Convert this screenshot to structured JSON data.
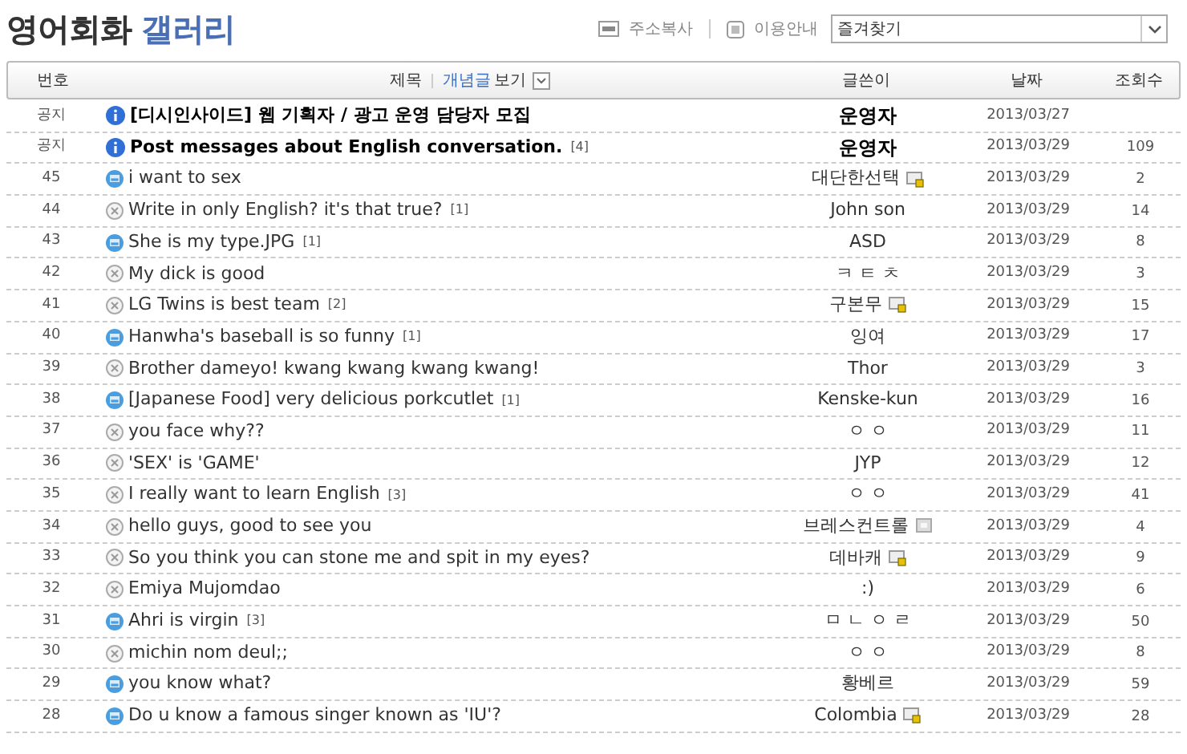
{
  "title": {
    "main": "영어회화",
    "accent": "갤러리"
  },
  "toolbar": {
    "copy_url": "주소복사",
    "guide": "이용안내",
    "favorites": "즐겨찾기"
  },
  "header": {
    "number": "번호",
    "subject": "제목",
    "concept": "개념글",
    "view": "보기",
    "writer": "글쓴이",
    "date": "날짜",
    "views": "조회수"
  },
  "rows": [
    {
      "number": "공지",
      "kind": "notice",
      "subject": "[디시인사이드] 웹 기획자 / 광고 운영 담당자 모집",
      "writer": "운영자",
      "writer_bold": true,
      "date": "2013/03/27"
    },
    {
      "number": "공지",
      "kind": "notice",
      "subject": "Post messages about English conversation.",
      "comments": "[4]",
      "writer": "운영자",
      "writer_bold": true,
      "date": "2013/03/29",
      "views": "109"
    },
    {
      "number": "45",
      "kind": "image",
      "subject": "i want to sex",
      "writer": "대단한선택",
      "badge": {
        "kind": "fixed"
      },
      "date": "2013/03/29",
      "views": "2"
    },
    {
      "number": "44",
      "kind": "text",
      "subject": "Write in only English? it's that true?",
      "comments": "[1]",
      "writer": "John son",
      "date": "2013/03/29",
      "views": "14"
    },
    {
      "number": "43",
      "kind": "image",
      "subject": "She is my type.JPG",
      "comments": "[1]",
      "writer": "ASD",
      "date": "2013/03/29",
      "views": "8"
    },
    {
      "number": "42",
      "kind": "text",
      "subject": "My dick is good",
      "writer": "ㅋ ㅌ ㅊ",
      "date": "2013/03/29",
      "views": "3"
    },
    {
      "number": "41",
      "kind": "text",
      "subject": "LG Twins is best team",
      "comments": "[2]",
      "writer": "구본무",
      "badge": {
        "kind": "fixed"
      },
      "date": "2013/03/29",
      "views": "15"
    },
    {
      "number": "40",
      "kind": "image",
      "subject": "Hanwha's baseball is so funny",
      "comments": "[1]",
      "writer": "잉여",
      "date": "2013/03/29",
      "views": "17"
    },
    {
      "number": "39",
      "kind": "text",
      "subject": "Brother dameyo! kwang kwang kwang kwang!",
      "writer": "Thor",
      "date": "2013/03/29",
      "views": "3"
    },
    {
      "number": "38",
      "kind": "image",
      "subject": "[Japanese Food] very delicious porkcutlet",
      "comments": "[1]",
      "writer": "Kenske-kun",
      "date": "2013/03/29",
      "views": "16"
    },
    {
      "number": "37",
      "kind": "text",
      "subject": "you face why??",
      "writer": "ㅇ ㅇ",
      "date": "2013/03/29",
      "views": "11"
    },
    {
      "number": "36",
      "kind": "text",
      "subject": "'SEX' is 'GAME'",
      "writer": "JYP",
      "date": "2013/03/29",
      "views": "12"
    },
    {
      "number": "35",
      "kind": "text",
      "subject": "I really want to learn English",
      "comments": "[3]",
      "writer": "ㅇ ㅇ",
      "date": "2013/03/29",
      "views": "41"
    },
    {
      "number": "34",
      "kind": "text",
      "subject": "hello guys, good to see you",
      "writer": "브레스컨트롤",
      "badge": {
        "kind": "half"
      },
      "date": "2013/03/29",
      "views": "4"
    },
    {
      "number": "33",
      "kind": "text",
      "subject": "So you think you can stone me and spit in my eyes?",
      "writer": "데바캐",
      "badge": {
        "kind": "fixed"
      },
      "date": "2013/03/29",
      "views": "9"
    },
    {
      "number": "32",
      "kind": "text",
      "subject": "Emiya Mujomdao",
      "writer": ":)",
      "date": "2013/03/29",
      "views": "6"
    },
    {
      "number": "31",
      "kind": "image",
      "subject": "Ahri is virgin",
      "comments": "[3]",
      "writer": "ㅁ ㄴ ㅇ ㄹ",
      "date": "2013/03/29",
      "views": "50"
    },
    {
      "number": "30",
      "kind": "text",
      "subject": "michin nom deul;;",
      "writer": "ㅇ ㅇ",
      "date": "2013/03/29",
      "views": "8"
    },
    {
      "number": "29",
      "kind": "image",
      "subject": "you know what?",
      "writer": "황베르",
      "date": "2013/03/29",
      "views": "59"
    },
    {
      "number": "28",
      "kind": "image",
      "subject": "Do u know a famous singer known as 'IU'?",
      "writer": "Colombia",
      "badge": {
        "kind": "fixed"
      },
      "date": "2013/03/29",
      "views": "28"
    }
  ]
}
